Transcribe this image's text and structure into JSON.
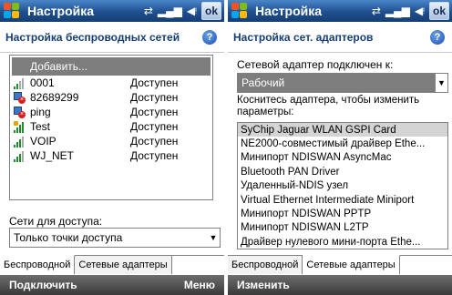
{
  "left": {
    "titlebar": {
      "title": "Настройка",
      "ok": "ok"
    },
    "header": "Настройка беспроводных сетей",
    "add_item": "Добавить...",
    "networks": [
      {
        "name": "0001",
        "status": "Доступен",
        "icon": "signal-icon"
      },
      {
        "name": "82689299",
        "status": "Доступен",
        "icon": "adhoc-network-icon"
      },
      {
        "name": "ping",
        "status": "Доступен",
        "icon": "adhoc-network-icon"
      },
      {
        "name": "Test",
        "status": "Доступен",
        "icon": "secure-signal-icon"
      },
      {
        "name": "VOIP",
        "status": "Доступен",
        "icon": "signal-icon"
      },
      {
        "name": "WJ_NET",
        "status": "Доступен",
        "icon": "signal-icon"
      }
    ],
    "access_label": "Сети для доступа:",
    "access_value": "Только точки доступа",
    "tabs": [
      "Беспроводной",
      "Сетевые адаптеры"
    ],
    "softkeys": {
      "left": "Подключить",
      "right": "Меню"
    }
  },
  "right": {
    "titlebar": {
      "title": "Настройка",
      "ok": "ok"
    },
    "header": "Настройка сет. адаптеров",
    "connect_label": "Сетевой адаптер подключен к:",
    "connect_value": "Рабочий",
    "hint": "Коснитесь адаптера, чтобы изменить параметры:",
    "adapters": [
      "SyChip Jaguar WLAN GSPI Card",
      "NE2000-совместимый драйвер Ethe...",
      "Минипорт NDISWAN AsyncMac",
      "Bluetooth PAN Driver",
      "Удаленный-NDIS узел",
      "Virtual Ethernet Intermediate Miniport",
      "Минипорт NDISWAN PPTP",
      "Минипорт NDISWAN L2TP",
      "Драйвер нулевого мини-порта Ethe..."
    ],
    "tabs": [
      "Беспроводной",
      "Сетевые адаптеры"
    ],
    "softkeys": {
      "left": "Изменить"
    }
  },
  "colors": {
    "titlebar": "#1f4f8f",
    "header_text": "#163e73",
    "selection": "#7d7d7d",
    "signal": "#1e8d2c"
  }
}
